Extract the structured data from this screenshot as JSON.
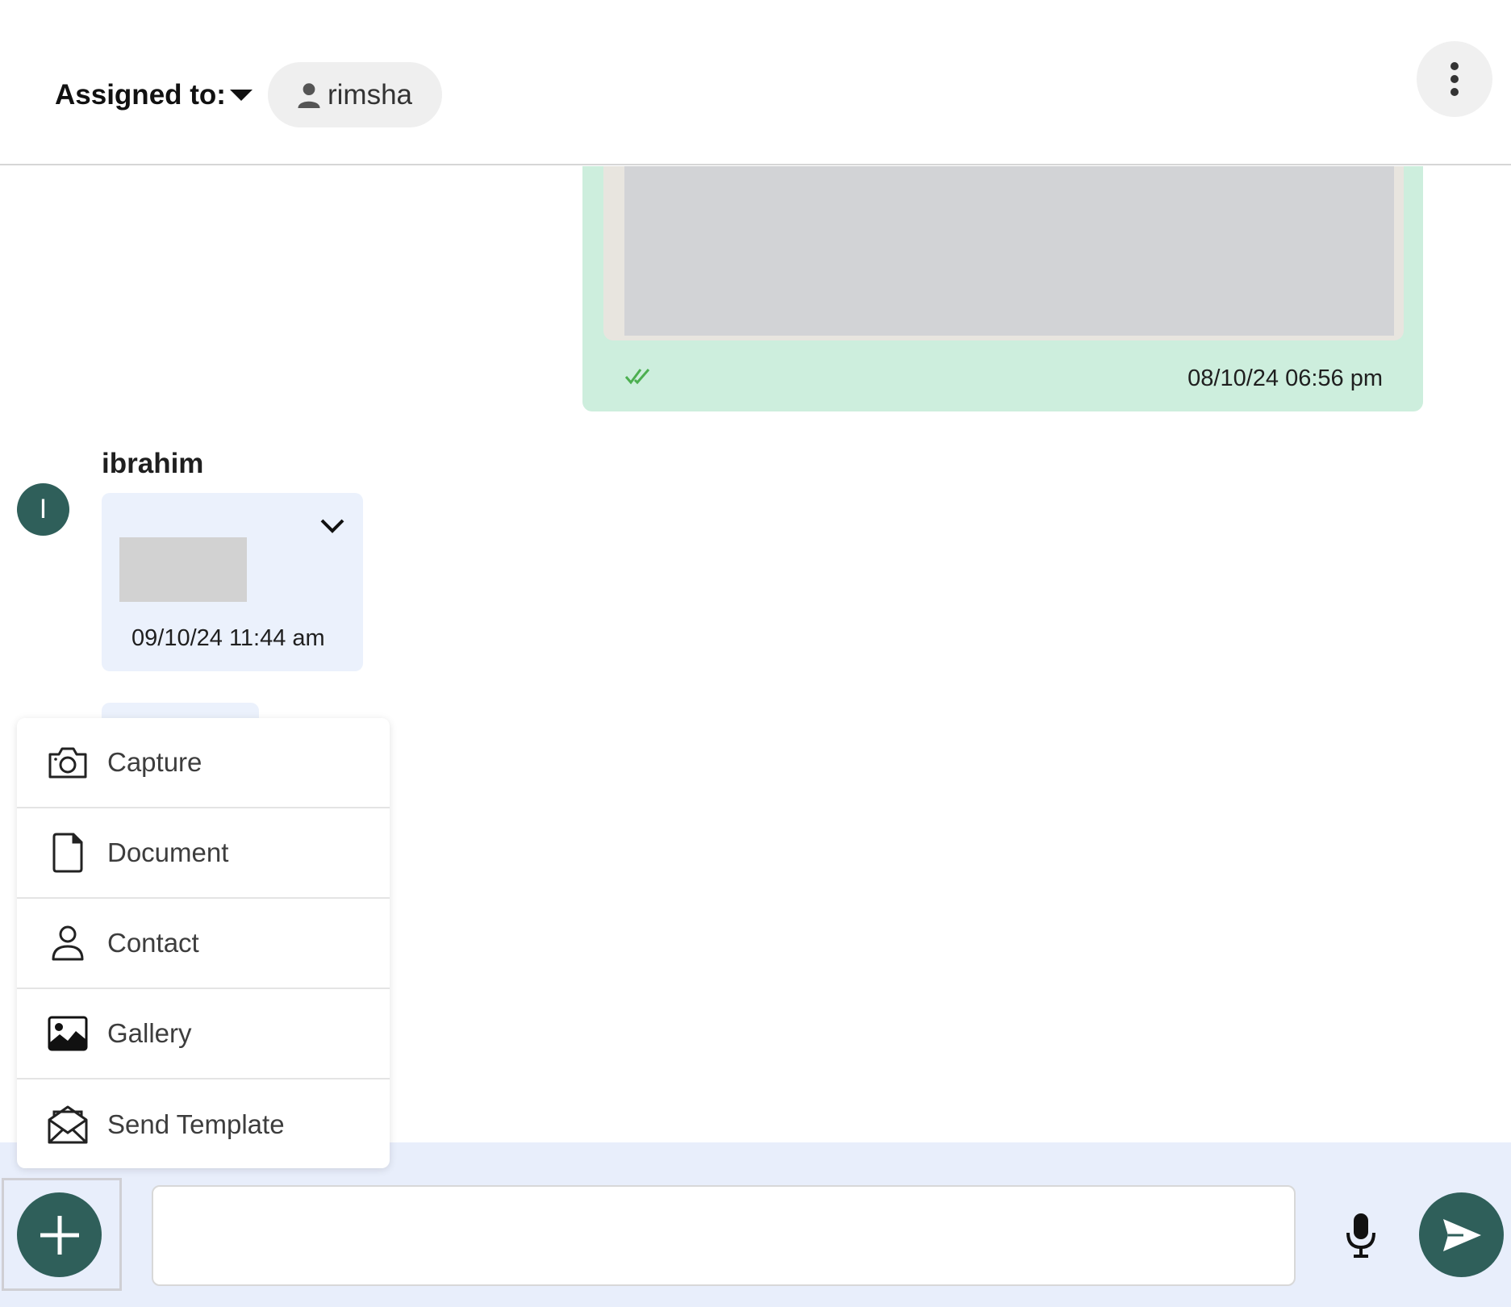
{
  "header": {
    "assigned_label": "Assigned to:",
    "assignee": "rimsha",
    "icons": {
      "assignee": "person-icon",
      "menu": "more-vertical-icon",
      "dropdown": "caret-down-icon"
    }
  },
  "messages": {
    "outgoing": {
      "timestamp": "08/10/24 06:56 pm",
      "status_icon": "double-check-icon"
    },
    "incoming": {
      "sender": "ibrahim",
      "avatar_initial": "I",
      "timestamp": "09/10/24 11:44 am",
      "options_icon": "chevron-down-icon"
    }
  },
  "attach_menu": {
    "items": [
      {
        "label": "Capture",
        "icon": "camera-icon"
      },
      {
        "label": "Document",
        "icon": "document-icon"
      },
      {
        "label": "Contact",
        "icon": "person-icon"
      },
      {
        "label": "Gallery",
        "icon": "image-icon"
      },
      {
        "label": "Send Template",
        "icon": "envelope-open-icon"
      }
    ]
  },
  "composer": {
    "message_value": "",
    "message_placeholder": "",
    "icons": {
      "attach": "plus-icon",
      "mic": "microphone-icon",
      "send": "send-icon"
    }
  },
  "colors": {
    "accent": "#2f5f5a",
    "outgoing_bubble": "#cdeedd",
    "incoming_bubble": "#ebf1fc",
    "composer_bg": "#e8eefb",
    "read_ticks": "#4caf50"
  }
}
